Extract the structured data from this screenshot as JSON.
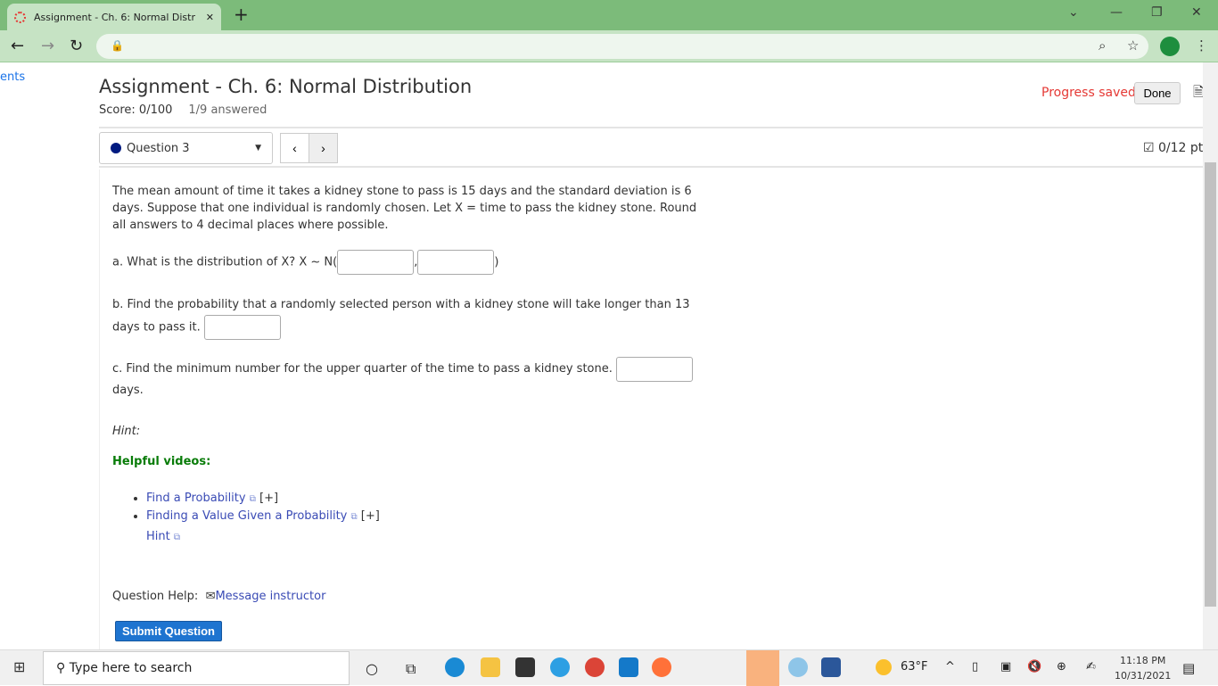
{
  "browser": {
    "tab_title": "Assignment - Ch. 6: Normal Distr",
    "new_tab": "+"
  },
  "sidebar": {
    "link": "ents"
  },
  "header": {
    "title": "Assignment - Ch. 6: Normal Distribution",
    "score": "Score: 0/100",
    "answered": "1/9 answered",
    "progress": "Progress saved",
    "done": "Done"
  },
  "question": {
    "selector": "Question 3",
    "prev": "‹",
    "next": "›",
    "points": "0/12 pt",
    "intro": "The mean amount of time it takes a kidney stone to pass is 15 days and the standard deviation is 6 days. Suppose that one individual is randomly chosen. Let X = time to pass the kidney stone. Round all answers to 4 decimal places where possible.",
    "a": "a. What is the distribution of X? X ~ N(",
    "a_sep": ",",
    "a_end": ")",
    "b": "b. Find the probability that a randomly selected person with a kidney stone will take longer than 13 days to pass it.",
    "c": "c. Find the minimum number for the upper quarter of the time to pass a kidney stone.",
    "c_end": "days.",
    "hint": "Hint:",
    "helpful": "Helpful videos:",
    "videos": [
      {
        "label": "Find a Probability",
        "more": "[+]"
      },
      {
        "label": "Finding a Value Given a Probability",
        "more": "[+]"
      }
    ],
    "hint_link": "Hint",
    "help_label": "Question Help:",
    "message": "Message instructor",
    "submit": "Submit Question"
  },
  "taskbar": {
    "search": "Type here to search",
    "weather": "63°F",
    "time": "11:18 PM",
    "date": "10/31/2021"
  }
}
